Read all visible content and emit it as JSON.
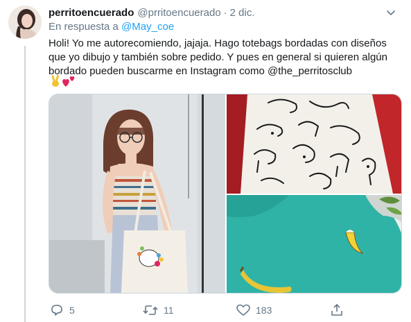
{
  "tweet": {
    "display_name": "perritoencuerado",
    "handle": "@prritoencuerado",
    "separator": "·",
    "date": "2 dic.",
    "reply_prefix": "En respuesta a",
    "reply_to": "@May_coe",
    "text": "Holi! Yo me autorecomiendo, jajaja. Hago totebags bordadas con diseños que yo dibujo y también sobre pedido. Y pues en general si quieren algún bordado pueden buscarme en Instagram como @the_perritosclub",
    "emojis": [
      "victory-hand",
      "two-hearts"
    ]
  },
  "actions": {
    "reply_count": "5",
    "retweet_count": "11",
    "like_count": "183",
    "share_label": ""
  },
  "colors": {
    "accent": "#1da1f2",
    "secondary_text": "#657786",
    "border": "#ccd6dd"
  }
}
